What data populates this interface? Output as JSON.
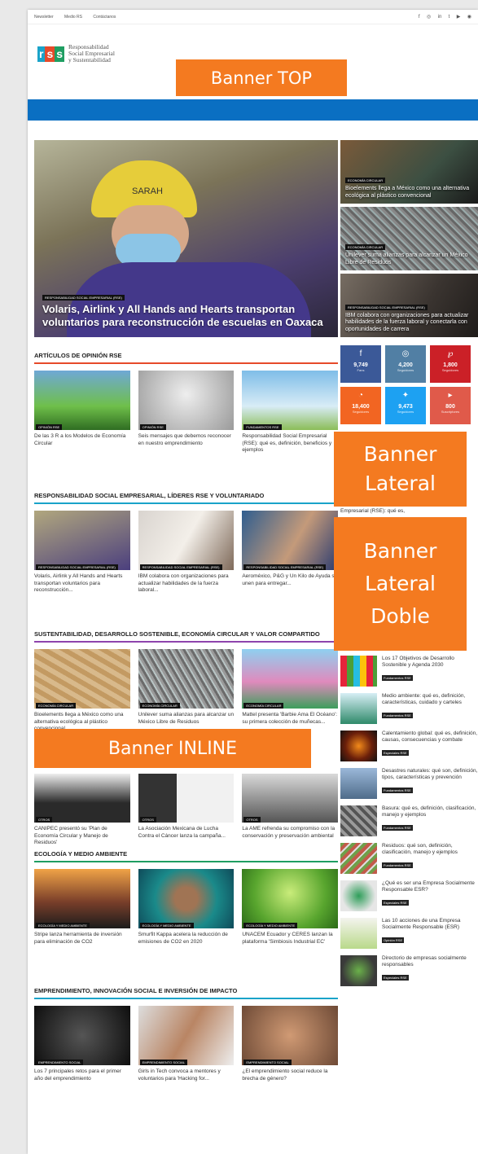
{
  "topbar": {
    "links": [
      "Newsletter",
      "Medio RS",
      "Contáctanos"
    ],
    "social": [
      "f",
      "◎",
      "in",
      "t",
      "▶",
      "◉"
    ]
  },
  "logo": {
    "letters": [
      "r",
      "s",
      "s"
    ],
    "line1": "Responsabilidad",
    "line2": "Social Empresarial",
    "line3": "y Sustentabilidad"
  },
  "banners": {
    "top": "Banner TOP",
    "lateral_1": "Banner",
    "lateral_2": "Lateral",
    "doble_1": "Banner",
    "doble_2": "Lateral",
    "doble_3": "Doble",
    "inline": "Banner INLINE"
  },
  "hero": {
    "tag": "RESPONSABILIDAD SOCIAL EMPRESARIAL (RSE)",
    "title": "Volaris, Airlink y All Hands and Hearts transportan voluntarios para reconstrucción de escuelas en Oaxaca",
    "helmet_text": "SARAH"
  },
  "side_stories": [
    {
      "tag": "ECONOMÍA CIRCULAR",
      "title": "Bioelements llega a México como una alternativa ecológica al plástico convencional"
    },
    {
      "tag": "ECONOMÍA CIRCULAR",
      "title": "Unilever suma alianzas para alcanzar un México Libre de Residuos"
    },
    {
      "tag": "RESPONSABILIDAD SOCIAL EMPRESARIAL (RSE)",
      "title": "IBM colabora con organizaciones para actualizar habilidades de la fuerza laboral y conectarla con oportunidades de carrera"
    }
  ],
  "sections": [
    {
      "title": "ARTÍCULOS DE OPINIÓN RSE",
      "cards": [
        {
          "tag": "Opinión RSE",
          "text": "De las 3 R a los Modelos de Economía Circular"
        },
        {
          "tag": "Opinión RSE",
          "text": "Seis mensajes que debemos reconocer en nuestro emprendimiento"
        },
        {
          "tag": "Fundamentos RSE",
          "text": "Responsabilidad Social Empresarial (RSE): qué es, definición, beneficios y ejemplos"
        }
      ]
    },
    {
      "title": "RESPONSABILIDAD SOCIAL EMPRESARIAL, LÍDERES RSE Y VOLUNTARIADO",
      "cards": [
        {
          "tag": "Responsabilidad Social Empresarial (RSE)",
          "text": "Volaris, Airlink y All Hands and Hearts transportan voluntarios para reconstrucción..."
        },
        {
          "tag": "Responsabilidad Social Empresarial (RSE)",
          "text": "IBM colabora con organizaciones para actualizar habilidades de la fuerza laboral..."
        },
        {
          "tag": "Responsabilidad Social Empresarial (RSE)",
          "text": "Aeroméxico, P&G y Un Kilo de Ayuda se unen para entregar..."
        }
      ]
    },
    {
      "title": "SUSTENTABILIDAD, DESARROLLO SOSTENIBLE, ECONOMÍA CIRCULAR Y VALOR COMPARTIDO",
      "cards": [
        {
          "tag": "Economía Circular",
          "text": "Bioelements llega a México como una alternativa ecológica al plástico convencional"
        },
        {
          "tag": "Economía Circular",
          "text": "Unilever suma alianzas para alcanzar un México Libre de Residuos"
        },
        {
          "tag": "Economía Circular",
          "text": "Mattel presenta 'Barbie Ama El Océano': su primera colección de muñecas..."
        }
      ]
    },
    {
      "title": "",
      "cards": [
        {
          "tag": "Otros",
          "text": "CANIPEC presentó su 'Plan de Economía Circular y Manejo de Residuos'"
        },
        {
          "tag": "Otros",
          "text": "La Asociación Mexicana de Lucha Contra el Cáncer lanza la campaña..."
        },
        {
          "tag": "Otros",
          "text": "La AME refrenda su compromiso con la conservación y preservación ambiental"
        }
      ]
    },
    {
      "title": "ECOLOGÍA Y MEDIO AMBIENTE",
      "cards": [
        {
          "tag": "Ecología y Medio Ambiente",
          "text": "Stripe lanza herramienta de inversión para eliminación de CO2"
        },
        {
          "tag": "Ecología y Medio Ambiente",
          "text": "Smurfit Kappa acelera la reducción de emisiones de CO2 en 2020"
        },
        {
          "tag": "Ecología y Medio Ambiente",
          "text": "UNACEM Ecuador y CERES lanzan la plataforma 'Simbiosis Industrial EC'"
        }
      ]
    },
    {
      "title": "EMPRENDIMIENTO, INNOVACIÓN SOCIAL E INVERSIÓN DE IMPACTO",
      "cards": [
        {
          "tag": "Emprendimiento Social",
          "text": "Los 7 principales retos para el primer año del emprendimiento"
        },
        {
          "tag": "Emprendimiento Social",
          "text": "Girls in Tech convoca a mentores y voluntarios para 'Hacking for..."
        },
        {
          "tag": "Emprendimiento Social",
          "text": "¿El emprendimiento social reduce la brecha de género?"
        }
      ]
    }
  ],
  "social_counts": [
    {
      "icon": "f",
      "count": "9,749",
      "label": "Fans",
      "color": "#3b5998"
    },
    {
      "icon": "◎",
      "count": "4,200",
      "label": "Seguidores",
      "color": "#517fa4"
    },
    {
      "icon": "℘",
      "count": "1,800",
      "label": "Seguidores",
      "color": "#cb2027"
    },
    {
      "icon": "◔",
      "count": "18,400",
      "label": "Seguidores",
      "color": "#f26522"
    },
    {
      "icon": "✦",
      "count": "9,473",
      "label": "Seguidores",
      "color": "#1da1f2"
    },
    {
      "icon": "▸",
      "count": "800",
      "label": "Suscriptores",
      "color": "#e05a4a"
    }
  ],
  "sidebar_fragment": "Empresarial (RSE): qué es,",
  "sidebar_list": [
    {
      "title": "Los 17 Objetivos de Desarrollo Sostenible y Agenda 2030",
      "badge": "Fundamentos RSE"
    },
    {
      "title": "Medio ambiente: qué es, definición, características, cuidado y carteles",
      "badge": "Fundamentos RSE"
    },
    {
      "title": "Calentamiento global: qué es, definición, causas, consecuencias y combate",
      "badge": "Especiales RSE"
    },
    {
      "title": "Desastres naturales: qué son, definición, tipos, características y prevención",
      "badge": "Fundamentos RSE"
    },
    {
      "title": "Basura: qué es, definición, clasificación, manejo y ejemplos",
      "badge": "Fundamentos RSE"
    },
    {
      "title": "Residuos: qué son, definición, clasificación, manejo y ejemplos",
      "badge": "Fundamentos RSE"
    },
    {
      "title": "¿Qué es ser una Empresa Socialmente Responsable ESR?",
      "badge": "Especiales RSE"
    },
    {
      "title": "Las 10 acciones de una Empresa Socialmente Responsable (ESR)",
      "badge": "Opinión RSE"
    },
    {
      "title": "Directorio de empresas socialmente responsables",
      "badge": "Especiales RSE"
    }
  ]
}
